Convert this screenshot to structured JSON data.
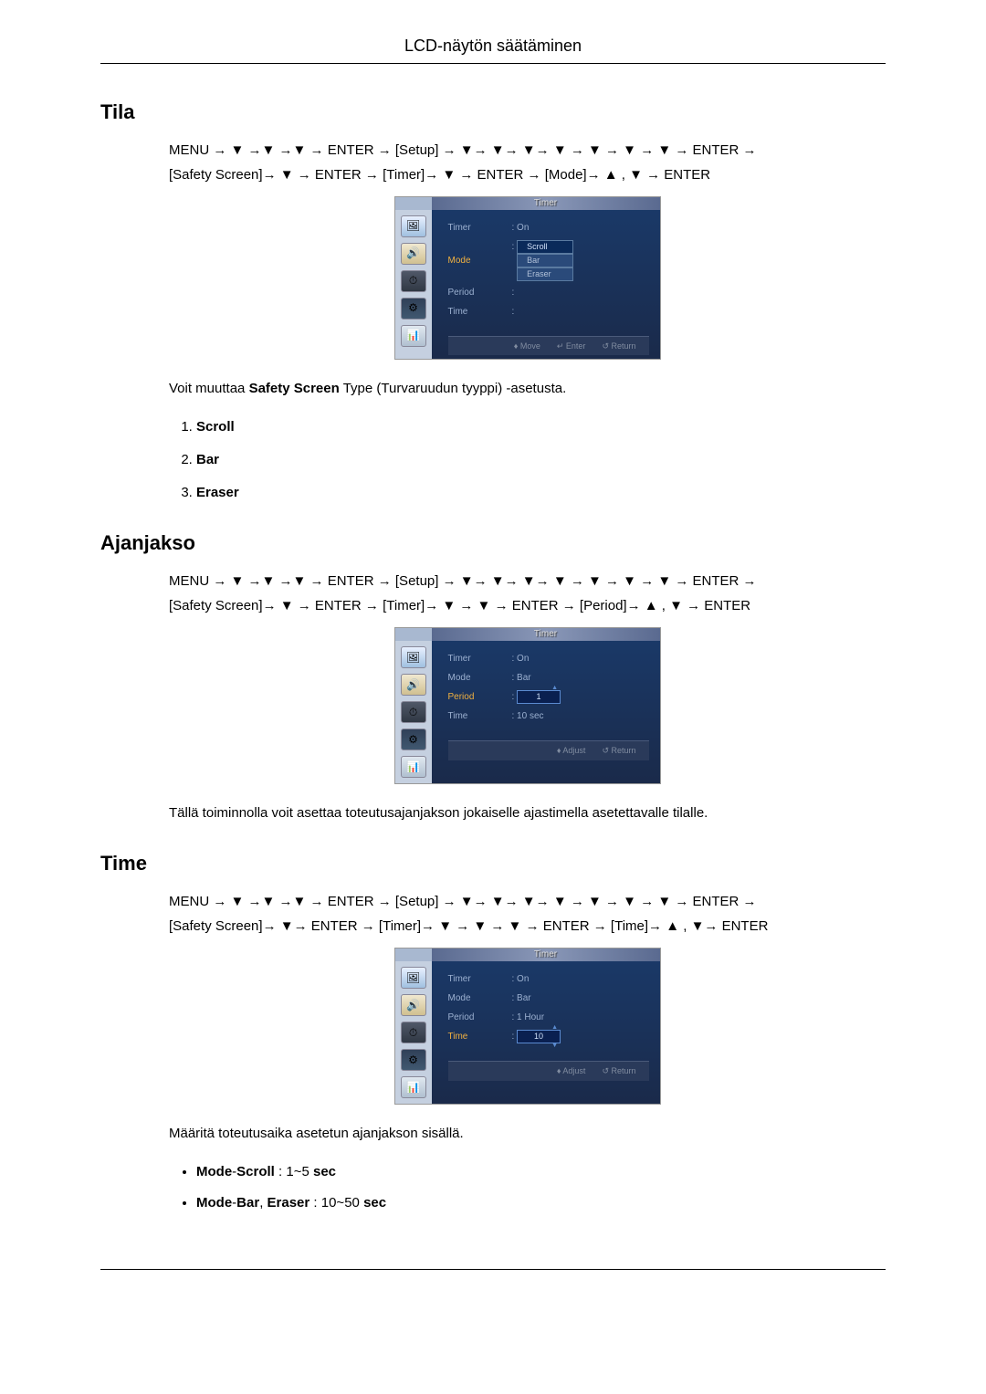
{
  "page_header": "LCD-näytön säätäminen",
  "sections": {
    "tila": {
      "title": "Tila",
      "nav_line1_pre": "MENU → ▼ →▼ →▼ → ENTER → ",
      "nav_setup": "[Setup]",
      "nav_line1_post": " → ▼→ ▼→ ▼→ ▼ → ▼ → ▼ → ▼ → ENTER →",
      "nav_line2_ss": "[Safety Screen]",
      "nav_line2_mid1": "→ ▼ → ENTER → ",
      "nav_line2_timer": "[Timer]",
      "nav_line2_mid2": "→ ▼ → ENTER → ",
      "nav_line2_mode": "[Mode]",
      "nav_line2_end": "→ ▲ , ▼ → ENTER",
      "osd": {
        "title": "Timer",
        "rows": [
          {
            "label": "Timer",
            "value": ": On"
          },
          {
            "label": "Mode",
            "value": "",
            "highlighted": true,
            "dropdown": [
              "Scroll",
              "Bar",
              "Eraser"
            ],
            "selected": 0
          },
          {
            "label": "Period",
            "value": ":"
          },
          {
            "label": "Time",
            "value": ":"
          }
        ],
        "footer": [
          "♦ Move",
          "↵ Enter",
          "↺ Return"
        ]
      },
      "desc_pre": "Voit muuttaa ",
      "desc_bold": "Safety Screen",
      "desc_post": " Type (Turvaruudun tyyppi) -asetusta.",
      "list": [
        "Scroll",
        "Bar",
        "Eraser"
      ]
    },
    "ajanjakso": {
      "title": "Ajanjakso",
      "nav_line1_pre": "MENU → ▼ →▼ →▼ → ENTER → ",
      "nav_setup": "[Setup]",
      "nav_line1_post": " → ▼→ ▼→ ▼→ ▼ → ▼ → ▼ → ▼ → ENTER →",
      "nav_line2_ss": "[Safety Screen]",
      "nav_line2_mid1": "→ ▼ → ENTER → ",
      "nav_line2_timer": "[Timer]",
      "nav_line2_mid2": "→ ▼ → ▼ → ENTER → ",
      "nav_line2_period": "[Period]",
      "nav_line2_end": "→ ▲ , ▼ → ENTER",
      "osd": {
        "title": "Timer",
        "rows": [
          {
            "label": "Timer",
            "value": ": On"
          },
          {
            "label": "Mode",
            "value": ": Bar"
          },
          {
            "label": "Period",
            "value": ":",
            "highlighted": true,
            "spinner": "1"
          },
          {
            "label": "Time",
            "value": ": 10 sec"
          }
        ],
        "footer": [
          "♦ Adjust",
          "↺ Return"
        ]
      },
      "desc": "Tällä toiminnolla voit asettaa toteutusajanjakson jokaiselle ajastimella asetettavalle tilalle."
    },
    "time": {
      "title": "Time",
      "nav_line1_pre": "MENU → ▼ →▼ →▼ → ENTER → ",
      "nav_setup": "[Setup]",
      "nav_line1_post": " → ▼→ ▼→ ▼→ ▼ → ▼ → ▼ → ▼ → ENTER →",
      "nav_line2_ss": "[Safety Screen]",
      "nav_line2_mid1": "→ ▼→ ENTER → ",
      "nav_line2_timer": "[Timer]",
      "nav_line2_mid2": "→ ▼ → ▼ → ▼ → ENTER → ",
      "nav_line2_time": "[Time]",
      "nav_line2_end": "→ ▲ , ▼→ ENTER",
      "osd": {
        "title": "Timer",
        "rows": [
          {
            "label": "Timer",
            "value": ": On"
          },
          {
            "label": "Mode",
            "value": ": Bar"
          },
          {
            "label": "Period",
            "value": ": 1 Hour"
          },
          {
            "label": "Time",
            "value": ":",
            "highlighted": true,
            "spinner": "10",
            "arrows_both": true
          }
        ],
        "footer": [
          "♦ Adjust",
          "↺ Return"
        ]
      },
      "desc": "Määritä toteutusaika asetetun ajanjakson sisällä.",
      "bullets": [
        {
          "bold1": "Mode",
          "sep1": "-",
          "bold2": "Scroll",
          "text": " : 1~5 ",
          "bold3": "sec"
        },
        {
          "bold1": "Mode",
          "sep1": "-",
          "bold2": "Bar",
          "sep2": ", ",
          "bold2b": "Eraser",
          "text": " : 10~50 ",
          "bold3": "sec"
        }
      ]
    }
  }
}
